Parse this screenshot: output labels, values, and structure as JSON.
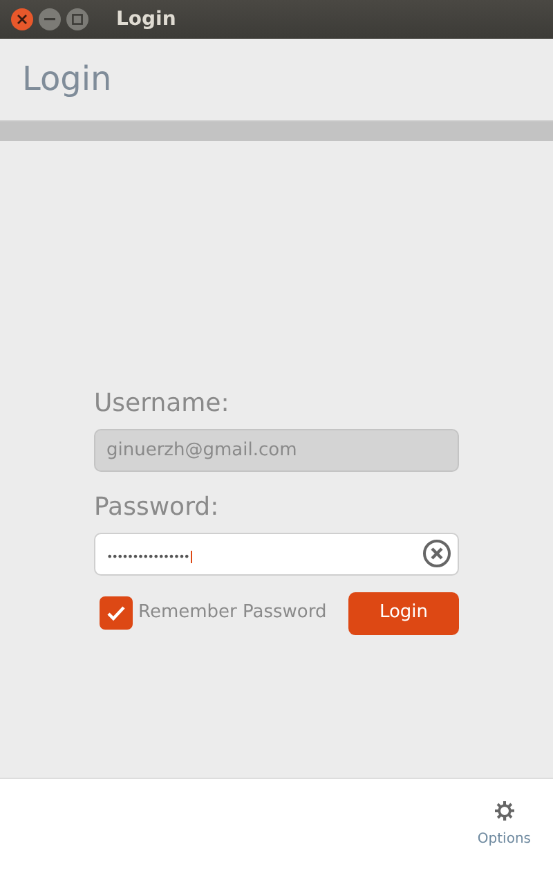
{
  "window": {
    "title": "Login"
  },
  "header": {
    "title": "Login"
  },
  "form": {
    "username": {
      "label": "Username:",
      "value": "ginuerzh@gmail.com",
      "disabled": true
    },
    "password": {
      "label": "Password:",
      "value": "••••••••••••••••"
    },
    "remember": {
      "label": "Remember Password",
      "checked": true
    },
    "submit": "Login"
  },
  "footer": {
    "options": "Options"
  }
}
